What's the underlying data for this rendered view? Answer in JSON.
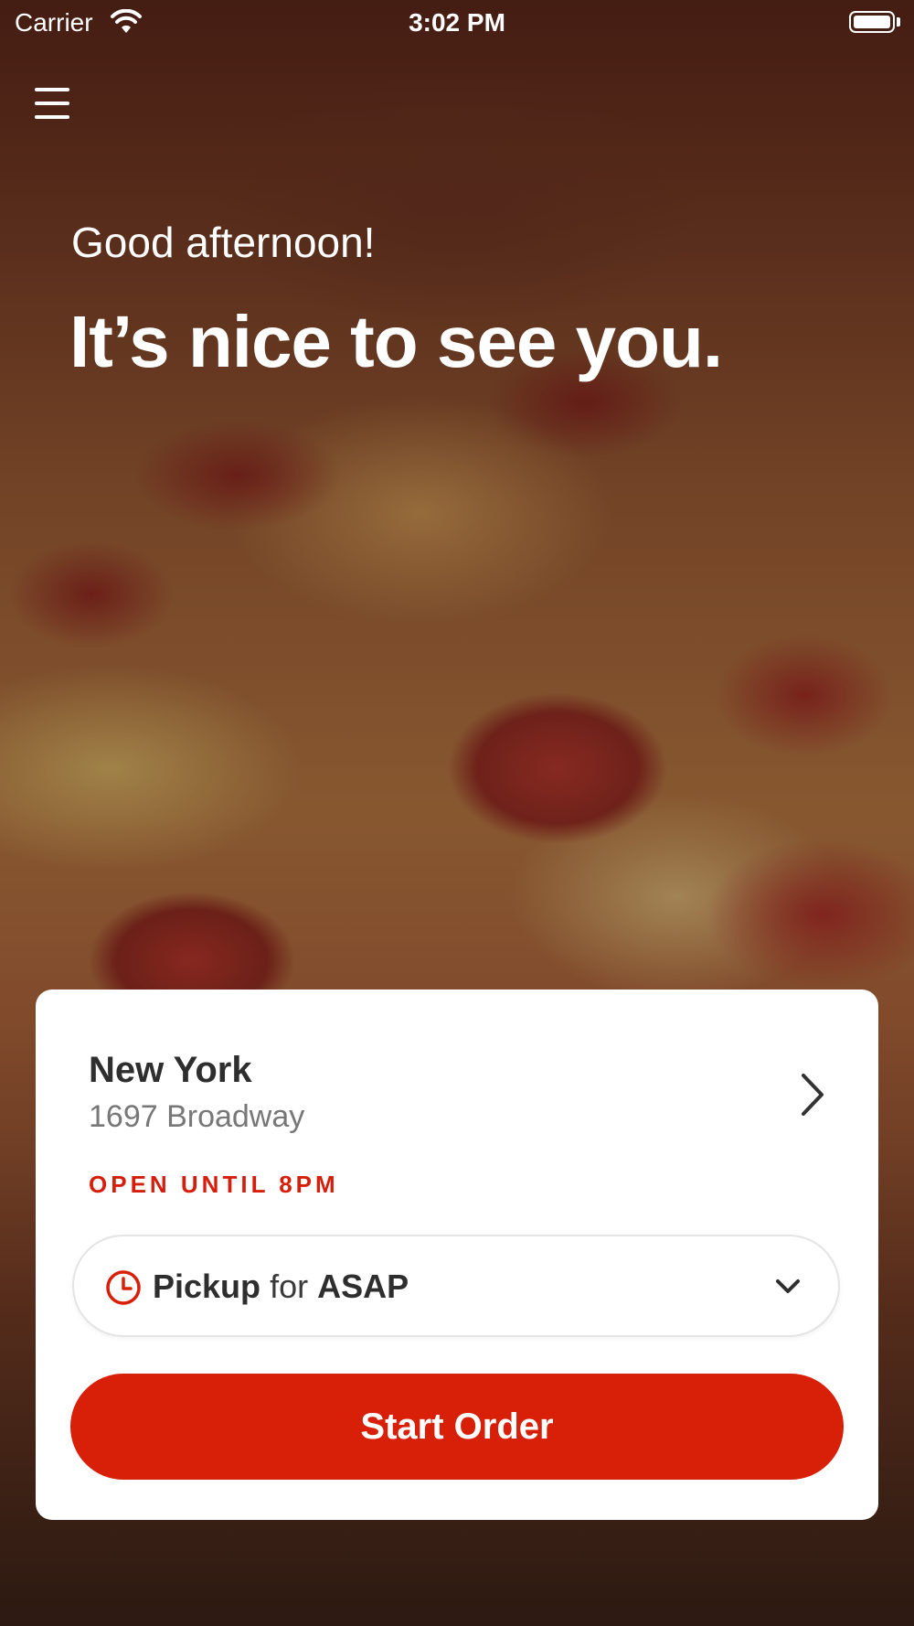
{
  "status_bar": {
    "carrier": "Carrier",
    "time": "3:02 PM"
  },
  "hero": {
    "greeting": "Good afternoon!",
    "headline": "It’s nice to see you."
  },
  "location": {
    "name": "New York",
    "address": "1697 Broadway",
    "hours": "OPEN UNTIL 8PM"
  },
  "order_mode": {
    "mode": "Pickup",
    "connector": "for",
    "time": "ASAP"
  },
  "actions": {
    "start_order_label": "Start Order"
  },
  "icons": {
    "menu": "hamburger-menu-icon",
    "wifi": "wifi-icon",
    "battery": "battery-icon",
    "location_chevron": "chevron-right-icon",
    "clock": "clock-icon",
    "dropdown": "chevron-down-icon"
  },
  "colors": {
    "brand_red": "#d81f08",
    "hours_red": "#d51f0c",
    "text_dark": "#2e2e2e",
    "text_muted": "#777777"
  }
}
